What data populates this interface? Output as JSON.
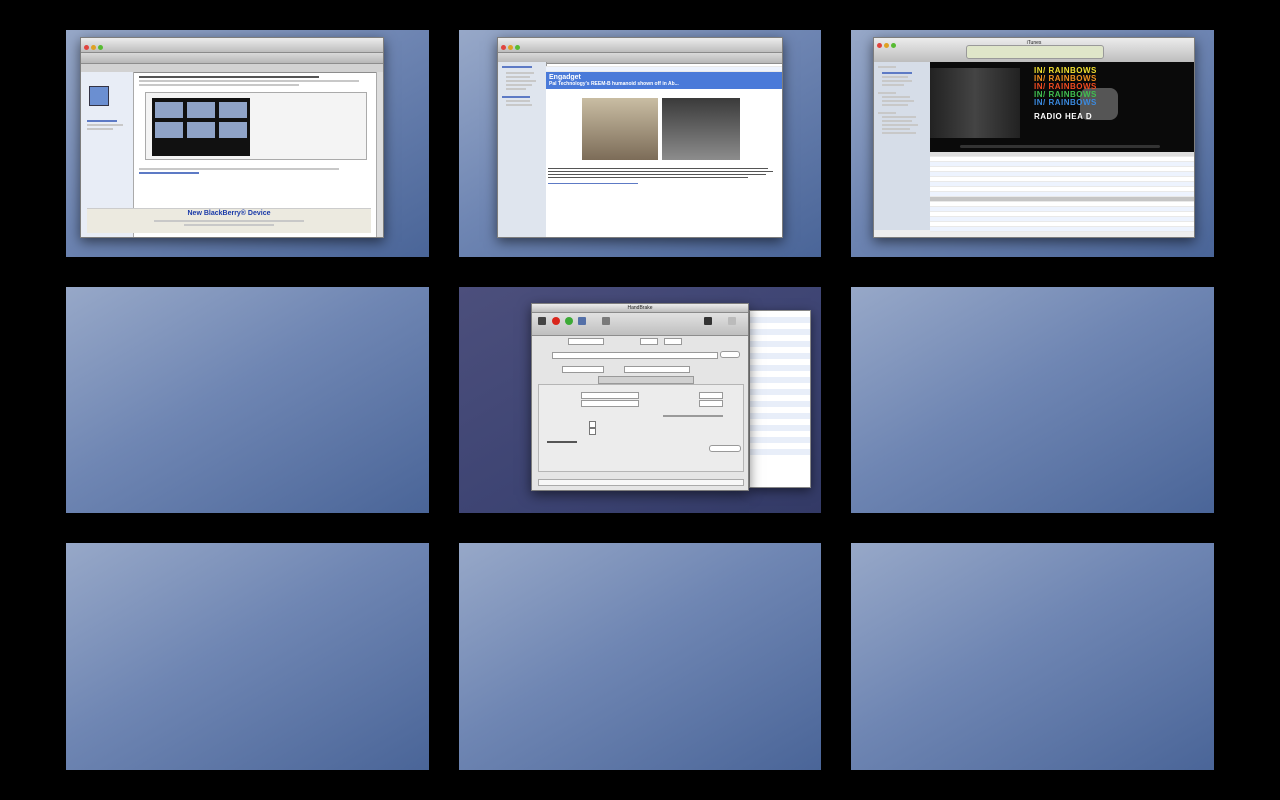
{
  "spaces": [
    {
      "index": 1,
      "app": "Safari"
    },
    {
      "index": 2,
      "app": "Mail"
    },
    {
      "index": 3,
      "app": "iTunes"
    },
    {
      "index": 4,
      "app": ""
    },
    {
      "index": 5,
      "app": "HandBrake"
    },
    {
      "index": 6,
      "app": ""
    },
    {
      "index": 7,
      "app": ""
    },
    {
      "index": 8,
      "app": ""
    },
    {
      "index": 9,
      "app": ""
    }
  ],
  "safari": {
    "ad_title": "New BlackBerry® Device"
  },
  "mail": {
    "feed_name": "Engadget",
    "headline": "Pal Technology's REEM-B humanoid shown off in Ab..."
  },
  "itunes": {
    "window_title": "iTunes",
    "album_text": [
      "IN/ RAINBOWS",
      "IN/ RAINBOWS",
      "IN/ RAINBOWS",
      "IN/ RAINBOWS",
      "IN/ RAINBOWS",
      "RADIO HEA D"
    ]
  },
  "handbrake": {
    "window_title": "HandBrake"
  },
  "colors": {
    "desktop_gradient_start": "#97a8c8",
    "desktop_gradient_end": "#4a6598",
    "active_space": "#3c4372",
    "feed_header": "#4a7ad9"
  }
}
